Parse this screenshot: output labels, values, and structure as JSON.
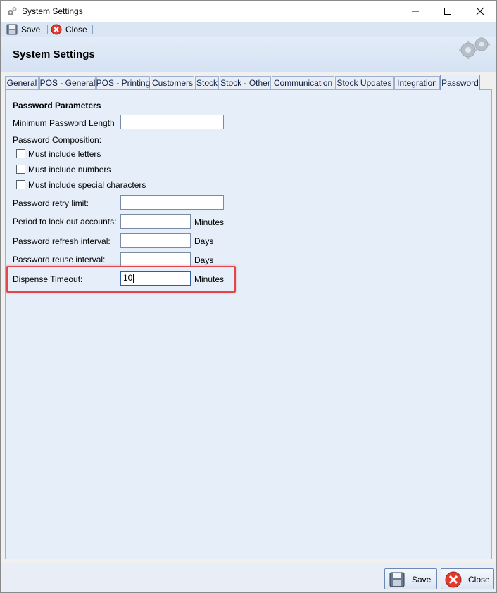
{
  "window": {
    "title": "System Settings",
    "minimize_glyph": "—",
    "maximize_glyph": "☐",
    "close_glyph": "✕"
  },
  "toolbar": {
    "save_label": "Save",
    "close_label": "Close"
  },
  "header": {
    "title": "System Settings",
    "icon": "gears-icon"
  },
  "tabs": [
    {
      "label": "General"
    },
    {
      "label": "POS - General"
    },
    {
      "label": "POS - Printing"
    },
    {
      "label": "Customers"
    },
    {
      "label": "Stock"
    },
    {
      "label": "Stock - Other"
    },
    {
      "label": "Communication"
    },
    {
      "label": "Stock Updates"
    },
    {
      "label": "Integration"
    },
    {
      "label": "Password",
      "active": true
    }
  ],
  "form": {
    "section_title": "Password Parameters",
    "min_length_label": "Minimum Password Length",
    "min_length_value": "",
    "composition_label": "Password Composition:",
    "composition_options": [
      {
        "label": "Must include letters",
        "checked": false
      },
      {
        "label": "Must include numbers",
        "checked": false
      },
      {
        "label": "Must include special characters",
        "checked": false
      }
    ],
    "retry_limit_label": "Password retry limit:",
    "retry_limit_value": "",
    "lockout_label": "Period to lock out accounts:",
    "lockout_value": "",
    "lockout_unit": "Minutes",
    "refresh_label": "Password refresh interval:",
    "refresh_value": "",
    "refresh_unit": "Days",
    "reuse_label": "Password reuse interval:",
    "reuse_value": "",
    "reuse_unit": "Days",
    "dispense_label": "Dispense Timeout:",
    "dispense_value": "10",
    "dispense_unit": "Minutes"
  },
  "footer": {
    "save_label": "Save",
    "close_label": "Close"
  },
  "colors": {
    "highlight_border": "#e0474c",
    "panel_bg": "#e5eef9",
    "toolbar_bg": "#dbe6f4"
  }
}
